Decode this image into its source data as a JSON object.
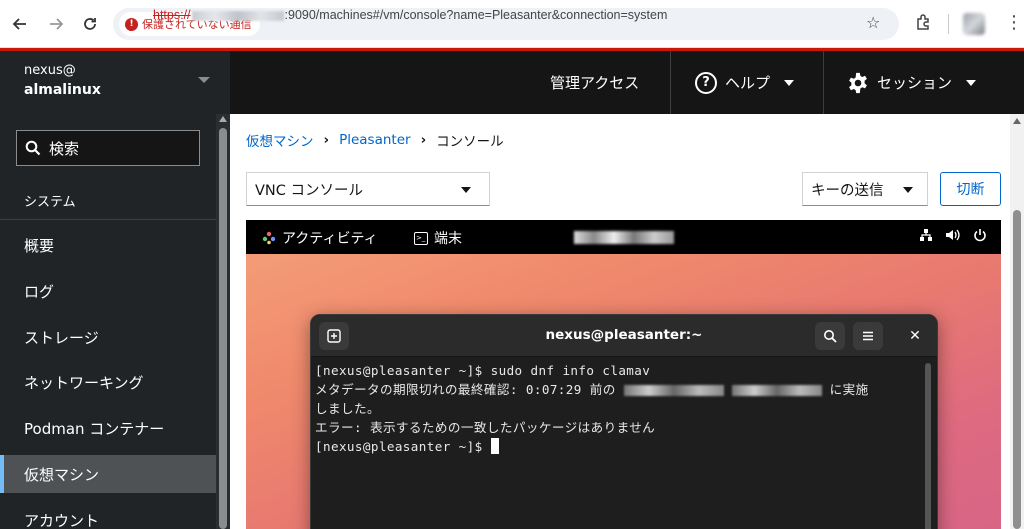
{
  "browser": {
    "security_label": "保護されていない通信",
    "url_scheme": "https://",
    "url_rest": ":9090/machines#/vm/console?name=Pleasanter&connection=system"
  },
  "host": {
    "user": "nexus@",
    "name": "almalinux"
  },
  "masthead": {
    "admin_access": "管理アクセス",
    "help": "ヘルプ",
    "session": "セッション"
  },
  "sidebar": {
    "search_placeholder": "検索",
    "section": "システム",
    "items": [
      {
        "label": "概要"
      },
      {
        "label": "ログ"
      },
      {
        "label": "ストレージ"
      },
      {
        "label": "ネットワーキング"
      },
      {
        "label": "Podman コンテナー"
      },
      {
        "label": "仮想マシン"
      },
      {
        "label": "アカウント"
      }
    ],
    "active_index": 5
  },
  "breadcrumb": {
    "items": [
      "仮想マシン",
      "Pleasanter"
    ],
    "current": "コンソール"
  },
  "toolbar": {
    "console_type": "VNC コンソール",
    "send_key": "キーの送信",
    "disconnect": "切断"
  },
  "gnome": {
    "activities": "アクティビティ",
    "terminal_app": "端末"
  },
  "terminal": {
    "title": "nexus@pleasanter:~",
    "lines": {
      "l1": "[nexus@pleasanter ~]$ sudo dnf info clamav",
      "l2a": "メタデータの期限切れの最終確認: 0:07:29 前の",
      "l2b": "に実施",
      "l3": "しました。",
      "l4": "エラー: 表示するための一致したパッケージはありません",
      "l5": "[nexus@pleasanter ~]$ "
    }
  },
  "colors": {
    "masthead": "#151515",
    "accent_red": "#c9190b",
    "link": "#0066cc",
    "active_border": "#73bcf7"
  }
}
